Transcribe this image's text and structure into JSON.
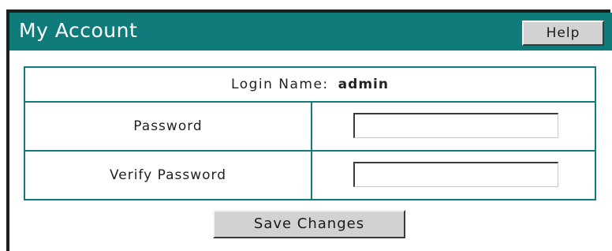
{
  "window": {
    "title": "My Account",
    "help_label": "Help"
  },
  "form": {
    "login_label": "Login Name:",
    "login_value": "admin",
    "password_label": "Password",
    "password_value": "",
    "verify_password_label": "Verify Password",
    "verify_password_value": "",
    "save_label": "Save Changes"
  },
  "colors": {
    "titlebar": "#0f7b7b",
    "table_border": "#137a7a",
    "button_face": "#d2d2d2"
  }
}
